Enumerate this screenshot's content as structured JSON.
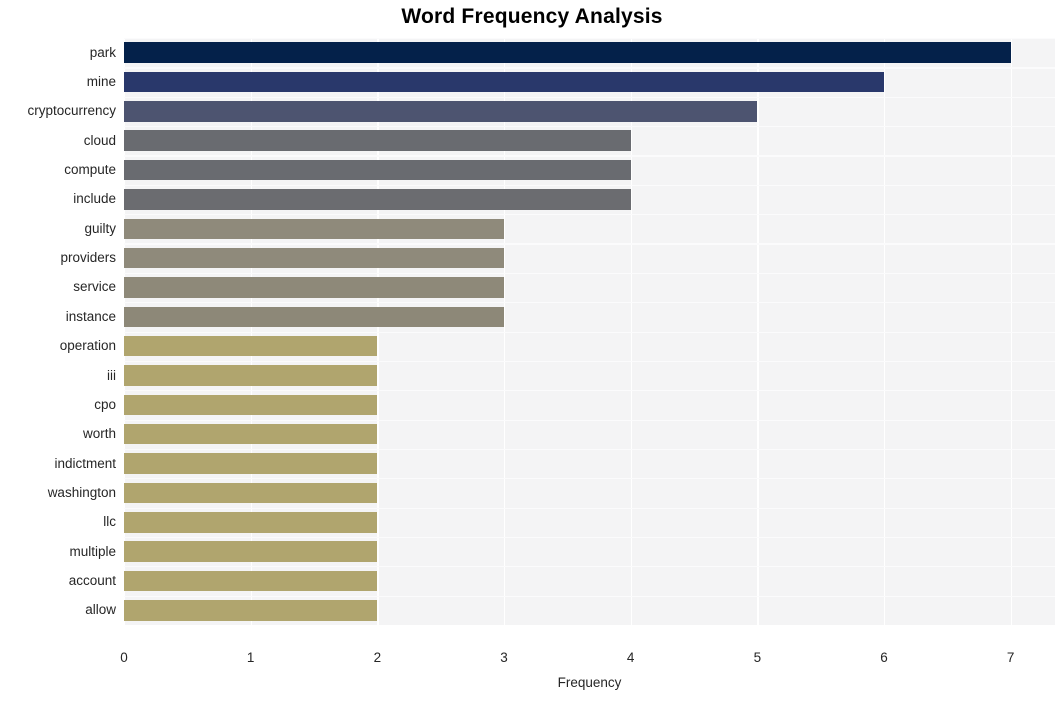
{
  "chart_data": {
    "type": "bar",
    "orientation": "horizontal",
    "title": "Word Frequency Analysis",
    "xlabel": "Frequency",
    "ylabel": "",
    "xlim": [
      0,
      7.35
    ],
    "ylim": [
      0,
      20
    ],
    "grid": true,
    "legend": false,
    "xticks": [
      "0",
      "1",
      "2",
      "3",
      "4",
      "5",
      "6",
      "7"
    ],
    "xtick_values": [
      0,
      1,
      2,
      3,
      4,
      5,
      6,
      7
    ],
    "categories": [
      "park",
      "mine",
      "cryptocurrency",
      "cloud",
      "compute",
      "include",
      "guilty",
      "providers",
      "service",
      "instance",
      "operation",
      "iii",
      "cpo",
      "worth",
      "indictment",
      "washington",
      "llc",
      "multiple",
      "account",
      "allow"
    ],
    "values": [
      7,
      6,
      5,
      4,
      4,
      4,
      3,
      3,
      3,
      3,
      2,
      2,
      2,
      2,
      2,
      2,
      2,
      2,
      2,
      2
    ],
    "colors": [
      "#04214a",
      "#29386b",
      "#4d5470",
      "#696b70",
      "#696b70",
      "#6b6c70",
      "#8f8a7b",
      "#8f8a7b",
      "#8e8979",
      "#8d8878",
      "#b0a56e",
      "#b0a56e",
      "#b0a56e",
      "#b0a56e",
      "#b0a56e",
      "#b0a56e",
      "#b0a56e",
      "#b0a56e",
      "#b0a56e",
      "#b0a56e"
    ],
    "plot_background": "#f4f4f5",
    "gridline_color": "#ffffff",
    "text_color": "#262626"
  }
}
